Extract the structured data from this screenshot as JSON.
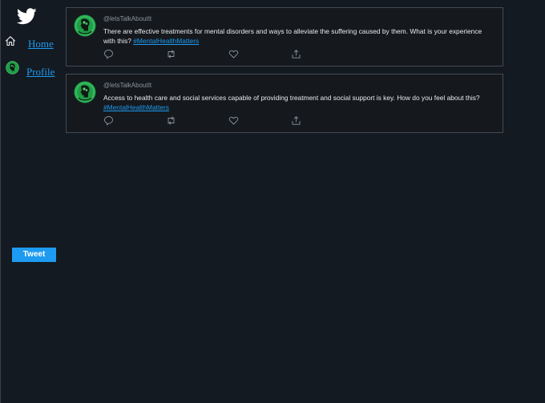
{
  "sidebar": {
    "logo_icon": "twitter-bird-icon",
    "items": [
      {
        "label": "Home",
        "icon": "home-icon"
      },
      {
        "label": "Profile",
        "icon": "brain-avatar-icon"
      }
    ],
    "tweet_button_label": "Tweet"
  },
  "colors": {
    "background": "#131a22",
    "card_background": "#15191e",
    "card_border": "#434a52",
    "accent": "#1d9bf0",
    "text": "#e8eaed",
    "muted": "#8c939b",
    "avatar_green": "#2ea44f"
  },
  "tweets": [
    {
      "handle": "@letsTalkAboutIt",
      "text": "There are effective treatments for mental disorders and ways to alleviate the suffering caused by them. What is your experience with this? ",
      "hashtag": "#MentalHealthMatters",
      "actions": [
        "reply-icon",
        "retweet-icon",
        "like-icon",
        "share-icon"
      ]
    },
    {
      "handle": "@letsTalkAboutIt",
      "text": "Access to health care and social services capable of providing treatment and social support is key. How do you feel about this? ",
      "hashtag": "#MentalHealthMatters",
      "actions": [
        "reply-icon",
        "retweet-icon",
        "like-icon",
        "share-icon"
      ]
    }
  ]
}
